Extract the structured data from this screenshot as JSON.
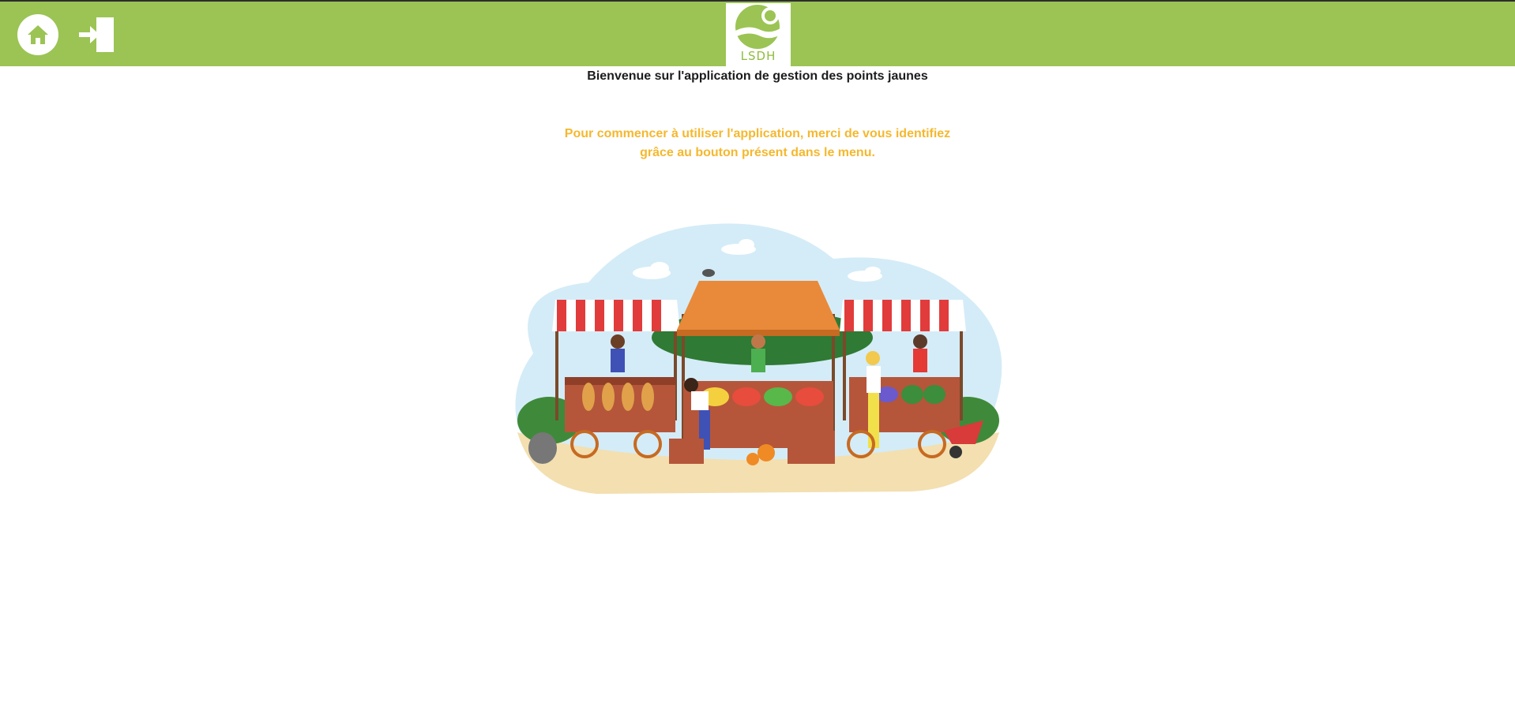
{
  "header": {
    "logo_text": "LSDH",
    "home_icon": "home-icon",
    "login_icon": "login-icon"
  },
  "main": {
    "welcome": "Bienvenue sur l'application de gestion des points jaunes",
    "instruction_line1": "Pour commencer à utiliser l'application, merci de vous identifiez",
    "instruction_line2": "grâce au bouton présent dans le menu."
  },
  "colors": {
    "header_green": "#9bc454",
    "accent_yellow": "#f5b82e"
  }
}
